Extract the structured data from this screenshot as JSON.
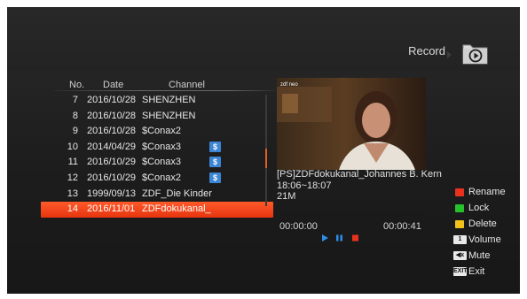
{
  "header": {
    "title": "Record",
    "icon": "folder-play-icon"
  },
  "list": {
    "columns": {
      "no": "No.",
      "date": "Date",
      "channel": "Channel"
    },
    "rows": [
      {
        "no": "7",
        "date": "2016/10/28",
        "channel": "SHENZHEN",
        "badge": ""
      },
      {
        "no": "8",
        "date": "2016/10/28",
        "channel": "SHENZHEN",
        "badge": ""
      },
      {
        "no": "9",
        "date": "2016/10/28",
        "channel": "$Conax2",
        "badge": ""
      },
      {
        "no": "10",
        "date": "2014/04/29",
        "channel": "$Conax3",
        "badge": "$"
      },
      {
        "no": "11",
        "date": "2016/10/29",
        "channel": "$Conax3",
        "badge": "$"
      },
      {
        "no": "12",
        "date": "2016/10/29",
        "channel": "$Conax2",
        "badge": "$"
      },
      {
        "no": "13",
        "date": "1999/09/13",
        "channel": "ZDF_Die Kinder",
        "badge": ""
      },
      {
        "no": "14",
        "date": "2016/11/01",
        "channel": "ZDFdokukanal_",
        "badge": ""
      }
    ],
    "selected_index": 7
  },
  "preview": {
    "logo": "zdf neo",
    "title": "[PS]ZDFdokukanal_Johannes B. Kern",
    "time_range": "18:06~18:07",
    "size": "21M",
    "progress": 0,
    "time_start": "00:00:00",
    "time_end": "00:00:41",
    "controls": [
      "play-icon",
      "pause-icon",
      "stop-icon"
    ]
  },
  "legend": [
    {
      "color": "#e8321d",
      "label": "Rename"
    },
    {
      "color": "#27c12b",
      "label": "Lock"
    },
    {
      "color": "#f1c21b",
      "label": "Delete"
    },
    {
      "key": "1",
      "label": "Volume"
    },
    {
      "key": "◀x",
      "label": "Mute"
    },
    {
      "key": "EXIT",
      "label": "Exit"
    }
  ],
  "colors": {
    "accent": "#ec4717",
    "badge": "#3d86d6",
    "background": "#222222"
  }
}
